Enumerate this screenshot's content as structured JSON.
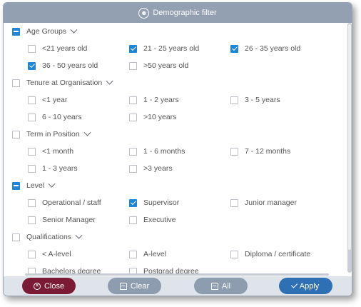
{
  "dialog": {
    "title": "Demographic filter"
  },
  "sections": [
    {
      "label": "Age Groups",
      "state": "partial",
      "options": [
        {
          "label": "<21 years old",
          "checked": false
        },
        {
          "label": "21 - 25 years old",
          "checked": true
        },
        {
          "label": "26 - 35 years old",
          "checked": true
        },
        {
          "label": "36 - 50 years old",
          "checked": true
        },
        {
          "label": ">50 years old",
          "checked": false
        }
      ]
    },
    {
      "label": "Tenure at Organisation",
      "state": "unchecked",
      "options": [
        {
          "label": "<1 year",
          "checked": false
        },
        {
          "label": "1 - 2 years",
          "checked": false
        },
        {
          "label": "3 - 5 years",
          "checked": false
        },
        {
          "label": "6 - 10 years",
          "checked": false
        },
        {
          "label": ">10 years",
          "checked": false
        }
      ]
    },
    {
      "label": "Term in Position",
      "state": "unchecked",
      "options": [
        {
          "label": "<1 month",
          "checked": false
        },
        {
          "label": "1 - 6 months",
          "checked": false
        },
        {
          "label": "7 - 12 months",
          "checked": false
        },
        {
          "label": "1 - 3 years",
          "checked": false
        },
        {
          "label": ">3 years",
          "checked": false
        }
      ]
    },
    {
      "label": "Level",
      "state": "partial",
      "options": [
        {
          "label": "Operational / staff",
          "checked": false
        },
        {
          "label": "Supervisor",
          "checked": true
        },
        {
          "label": "Junior manager",
          "checked": false
        },
        {
          "label": "Senior Manager",
          "checked": false
        },
        {
          "label": "Executive",
          "checked": false
        }
      ]
    },
    {
      "label": "Qualifications",
      "state": "unchecked",
      "options": [
        {
          "label": "< A-level",
          "checked": false
        },
        {
          "label": "A-level",
          "checked": false
        },
        {
          "label": "Diploma / certificate",
          "checked": false
        },
        {
          "label": "Bachelors degree",
          "checked": false
        },
        {
          "label": "Postgrad degree",
          "checked": false
        }
      ]
    }
  ],
  "footer": {
    "close_label": "Close",
    "clear_label": "Clear",
    "all_label": "All",
    "apply_label": "Apply"
  },
  "colors": {
    "title_bar": "#93a0b1",
    "checkbox_accent": "#1e86d8",
    "close_button": "#7b1a35",
    "neutral_button": "#8e9cb0",
    "apply_button": "#2f6fb3"
  },
  "icons": {
    "title": "person-silhouette-icon",
    "close": "circle-x-icon",
    "clear": "box-minus-icon",
    "all": "box-minus-icon",
    "apply": "check-icon"
  }
}
